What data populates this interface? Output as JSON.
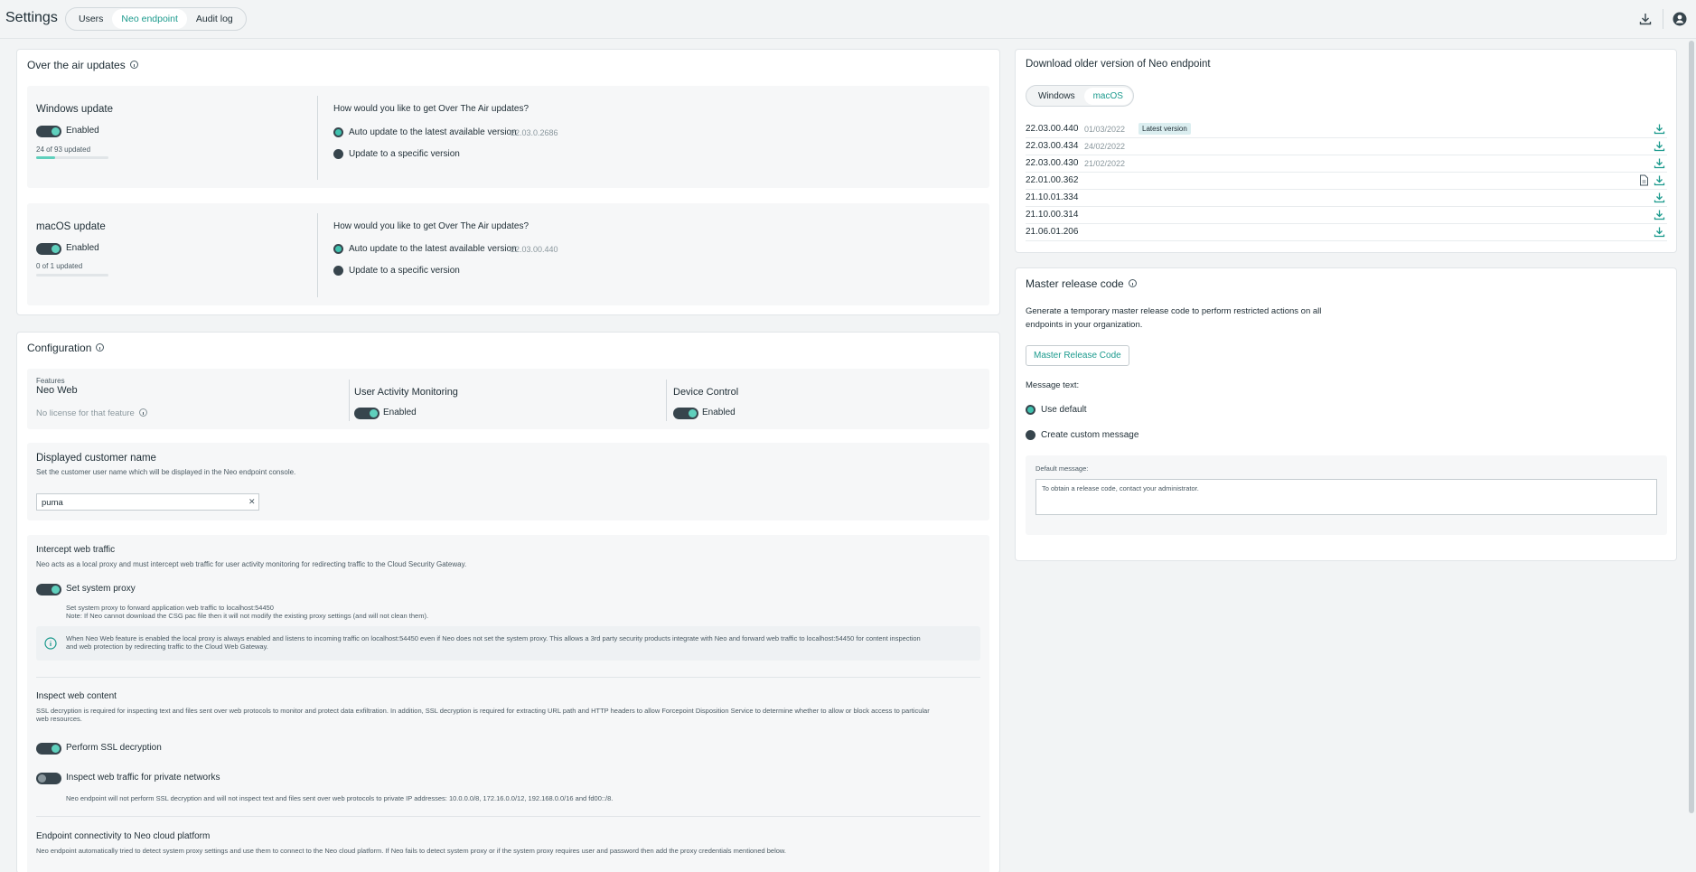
{
  "header": {
    "title": "Settings",
    "tabs": [
      {
        "label": "Users"
      },
      {
        "label": "Neo endpoint"
      },
      {
        "label": "Audit log"
      }
    ],
    "active_tab": "Neo endpoint",
    "icons": [
      "download-icon",
      "user-avatar-icon"
    ]
  },
  "ota": {
    "title": "Over the air updates",
    "windows": {
      "title": "Windows update",
      "toggle_label": "Enabled",
      "progress_text": "24 of 93 updated",
      "progress_fraction": 0.26,
      "question": "How would you like to get Over The Air updates?",
      "option_auto": "Auto update to the latest available version",
      "auto_version": "22.03.0.2686",
      "option_specific": "Update to a specific version"
    },
    "macos": {
      "title": "macOS update",
      "toggle_label": "Enabled",
      "progress_text": "0 of 1 updated",
      "progress_fraction": 0,
      "question": "How would you like to get Over The Air updates?",
      "option_auto": "Auto update to the latest available version",
      "auto_version": "22.03.00.440",
      "option_specific": "Update to a specific version"
    }
  },
  "configuration": {
    "title": "Configuration",
    "features_label": "Features",
    "neo_web": {
      "title": "Neo Web",
      "status": "No license for that feature"
    },
    "uam": {
      "title": "User Activity Monitoring",
      "toggle_label": "Enabled"
    },
    "device_control": {
      "title": "Device Control",
      "toggle_label": "Enabled"
    },
    "customer_name": {
      "title": "Displayed customer name",
      "desc": "Set the customer user name which will be displayed in the Neo endpoint console.",
      "value": "puma"
    },
    "intercept": {
      "title": "Intercept web traffic",
      "desc": "Neo acts as a local proxy and must intercept web traffic for user activity monitoring for redirecting traffic to the Cloud Security Gateway.",
      "proxy_toggle_label": "Set system proxy",
      "proxy_note1": "Set system proxy to forward application web traffic to localhost:54450",
      "proxy_note2": "Note: If Neo cannot download the CSG pac file then it will not modify the existing proxy settings (and will not clean them).",
      "info1": "When Neo Web feature is enabled the local proxy is always enabled and listens to incoming traffic on localhost:54450 even if Neo does not set the system proxy. This allows a 3rd party security products integrate with Neo and forward web traffic to localhost:54450 for content inspection",
      "info2": "and web protection by redirecting traffic to the Cloud Web Gateway."
    },
    "inspect": {
      "title": "Inspect web content",
      "desc1": "SSL decryption is required for inspecting text and files sent over web protocols to monitor and protect data exfiltration. In addition, SSL decryption is required for extracting URL path and HTTP headers to allow Forcepoint Disposition Service to determine whether to allow or block access to particular",
      "desc2": "web resources.",
      "ssl_label": "Perform SSL decryption",
      "private_label": "Inspect web traffic for private networks",
      "private_note": "Neo endpoint will not perform SSL decryption and will not inspect text and files sent over web protocols to private IP addresses: 10.0.0.0/8, 172.16.0.0/12, 192.168.0.0/16 and fd00::/8."
    },
    "connectivity": {
      "title": "Endpoint connectivity to Neo cloud platform",
      "desc": "Neo endpoint automatically tried to detect system proxy settings and use them to connect to the Neo cloud platform. If Neo fails to detect system proxy or if the system proxy requires user and password then add the proxy credentials mentioned below."
    }
  },
  "downloads": {
    "title": "Download older version of Neo endpoint",
    "os_tabs": [
      {
        "label": "Windows"
      },
      {
        "label": "macOS"
      }
    ],
    "active_os": "macOS",
    "latest_badge": "Latest version",
    "rows": [
      {
        "version": "22.03.00.440",
        "date": "01/03/2022",
        "latest": true,
        "doc": false
      },
      {
        "version": "22.03.00.434",
        "date": "24/02/2022",
        "latest": false,
        "doc": false
      },
      {
        "version": "22.03.00.430",
        "date": "21/02/2022",
        "latest": false,
        "doc": false
      },
      {
        "version": "22.01.00.362",
        "date": "",
        "latest": false,
        "doc": true
      },
      {
        "version": "21.10.01.334",
        "date": "",
        "latest": false,
        "doc": false
      },
      {
        "version": "21.10.00.314",
        "date": "",
        "latest": false,
        "doc": false
      },
      {
        "version": "21.06.01.206",
        "date": "",
        "latest": false,
        "doc": false
      }
    ]
  },
  "master": {
    "title": "Master release code",
    "desc1": "Generate a temporary master release code to perform restricted actions on all",
    "desc2": "endpoints in your organization.",
    "button": "Master Release Code",
    "message_label": "Message text:",
    "option_default": "Use default",
    "option_custom": "Create custom message",
    "default_label": "Default message:",
    "default_text": "To obtain a release code, contact your administrator."
  },
  "colors": {
    "accent": "#1b9a8d",
    "toggle_on": "#5fd0bd",
    "toggle_track": "#37454d"
  }
}
